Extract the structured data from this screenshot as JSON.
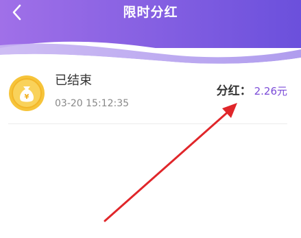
{
  "header": {
    "title": "限时分红",
    "back_icon": "chevron-left-icon",
    "gradient_start": "#9b6ee8",
    "gradient_end": "#6a4ed8"
  },
  "record": {
    "icon": "money-bag-coin-icon",
    "status": "已结束",
    "time": "03-20 15:12:35",
    "dividend_label": "分红：",
    "dividend_amount": "2.26元",
    "amount_color": "#7a4ad8"
  },
  "annotation": {
    "arrow_color": "#e0262a"
  }
}
